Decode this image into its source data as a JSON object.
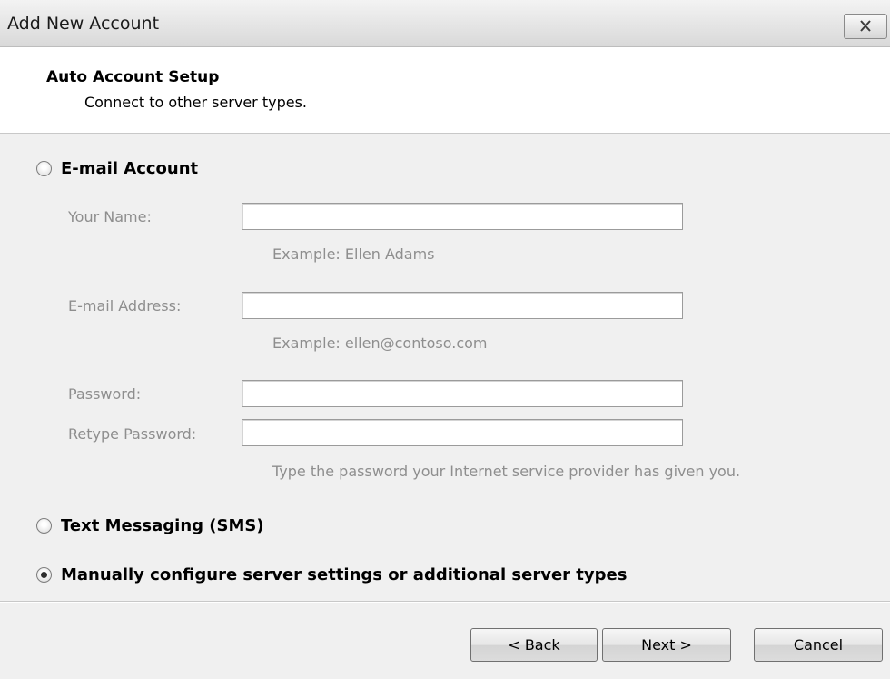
{
  "window": {
    "title": "Add New Account"
  },
  "header": {
    "title": "Auto Account Setup",
    "subtitle": "Connect to other server types."
  },
  "options": {
    "email_account": {
      "label": "E-mail Account",
      "selected": false
    },
    "sms": {
      "label": "Text Messaging (SMS)",
      "selected": false
    },
    "manual": {
      "label": "Manually configure server settings or additional server types",
      "selected": true
    }
  },
  "fields": {
    "name": {
      "label": "Your Name:",
      "value": "",
      "hint": "Example: Ellen Adams"
    },
    "email": {
      "label": "E-mail Address:",
      "value": "",
      "hint": "Example: ellen@contoso.com"
    },
    "password": {
      "label": "Password:",
      "value": ""
    },
    "retype": {
      "label": "Retype Password:",
      "value": "",
      "hint": "Type the password your Internet service provider has given you."
    }
  },
  "buttons": {
    "back": "< Back",
    "next": "Next >",
    "cancel": "Cancel"
  },
  "icons": {
    "close": "close-icon"
  },
  "colors": {
    "disabled_text": "#8e8e8e",
    "dialog_bg": "#f0f0f0",
    "header_bg": "#ffffff"
  }
}
